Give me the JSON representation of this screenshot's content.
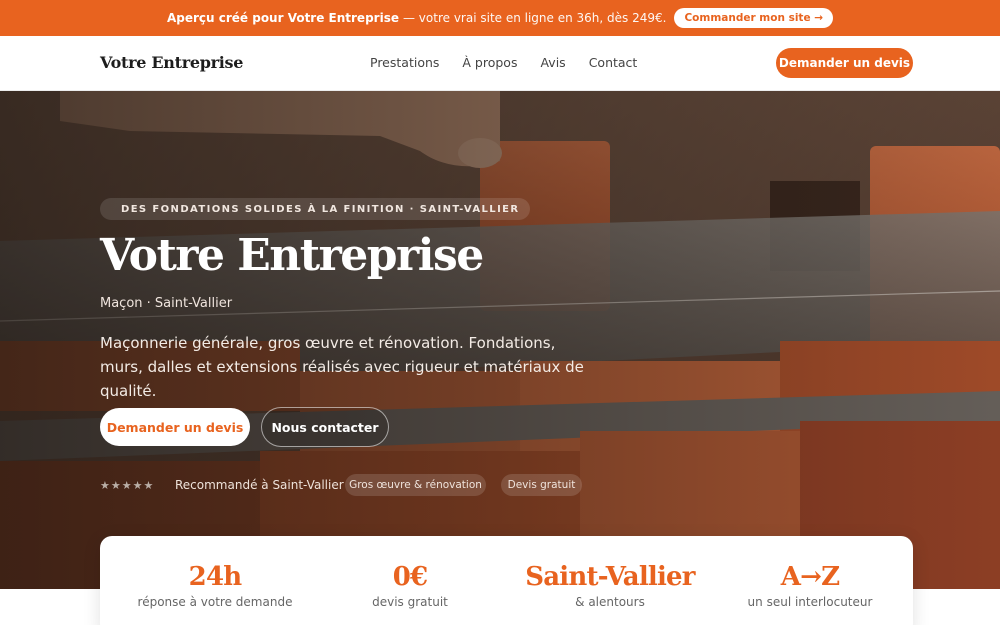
{
  "promo": {
    "strong": "Aperçu créé pour Votre Entreprise",
    "rest": "— votre vrai site en ligne en 36h, dès 249€.",
    "cta": "Commander mon site →"
  },
  "nav": {
    "brand": "Votre Entreprise",
    "items": [
      "Prestations",
      "À propos",
      "Avis",
      "Contact"
    ],
    "cta": "Demander un devis"
  },
  "hero": {
    "tagline": "DES FONDATIONS SOLIDES À LA FINITION · SAINT-VALLIER",
    "title": "Votre Entreprise",
    "subtitle": "Maçon · Saint-Vallier",
    "description": "Maçonnerie générale, gros œuvre et rénovation. Fondations, murs, dalles et extensions réalisés avec rigueur et matériaux de qualité.",
    "primary_cta": "Demander un devis",
    "secondary_cta": "Nous contacter",
    "stars": "★★★★★",
    "recommendation": "Recommandé à Saint-Vallier",
    "pills": [
      "Gros œuvre & rénovation",
      "Devis gratuit"
    ]
  },
  "stats": [
    {
      "value": "24h",
      "label": "réponse à votre demande"
    },
    {
      "value": "0€",
      "label": "devis gratuit"
    },
    {
      "value": "Saint-Vallier",
      "label": "& alentours"
    },
    {
      "value": "A→Z",
      "label": "un seul interlocuteur"
    }
  ],
  "colors": {
    "accent": "#e8631f",
    "text": "#1d1d1d"
  }
}
